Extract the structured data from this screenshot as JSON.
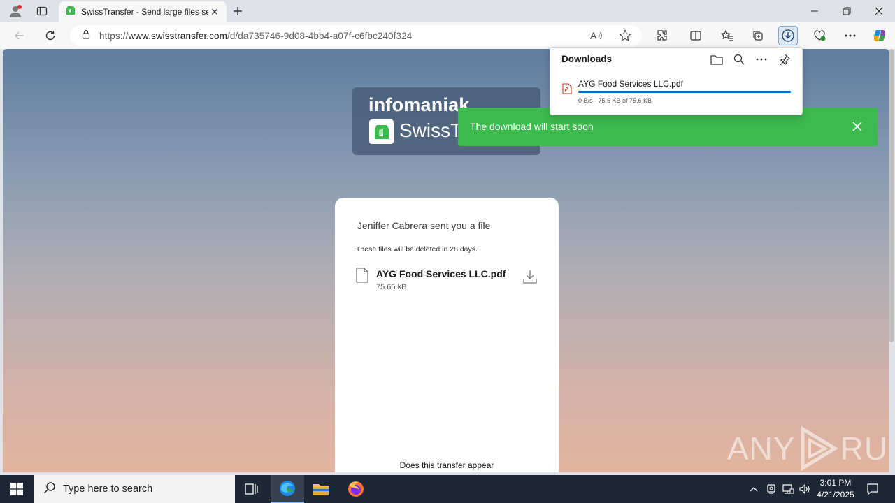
{
  "browser": {
    "tab": {
      "title": "SwissTransfer - Send large files se",
      "icon": "swisstransfer-favicon"
    },
    "address": {
      "url_prefix": "https://",
      "url_domain": "www.swisstransfer.com",
      "url_path": "/d/da735746-9d08-4bb4-a07f-c6fbc240f324"
    }
  },
  "page": {
    "logo": {
      "brand": "infomaniak",
      "product": "SwissT"
    },
    "card": {
      "sender_line": "Jeniffer Cabrera sent you a file",
      "expiry_note": "These files will be deleted in 28 days.",
      "file": {
        "name": "AYG Food Services LLC.pdf",
        "size": "75.65 kB"
      },
      "footer_text": "Does this transfer appear"
    },
    "toast": {
      "message": "The download will start soon",
      "color": "#3dba4e"
    },
    "watermark": {
      "left": "ANY",
      "right": "RUN"
    }
  },
  "downloads_panel": {
    "title": "Downloads",
    "item": {
      "name": "AYG Food Services LLC.pdf",
      "status": "0 B/s - 75.6 KB of 75.6 KB",
      "progress_percent": 100
    }
  },
  "taskbar": {
    "search_placeholder": "Type here to search",
    "clock": {
      "time": "3:01 PM",
      "date": "4/21/2025"
    }
  }
}
